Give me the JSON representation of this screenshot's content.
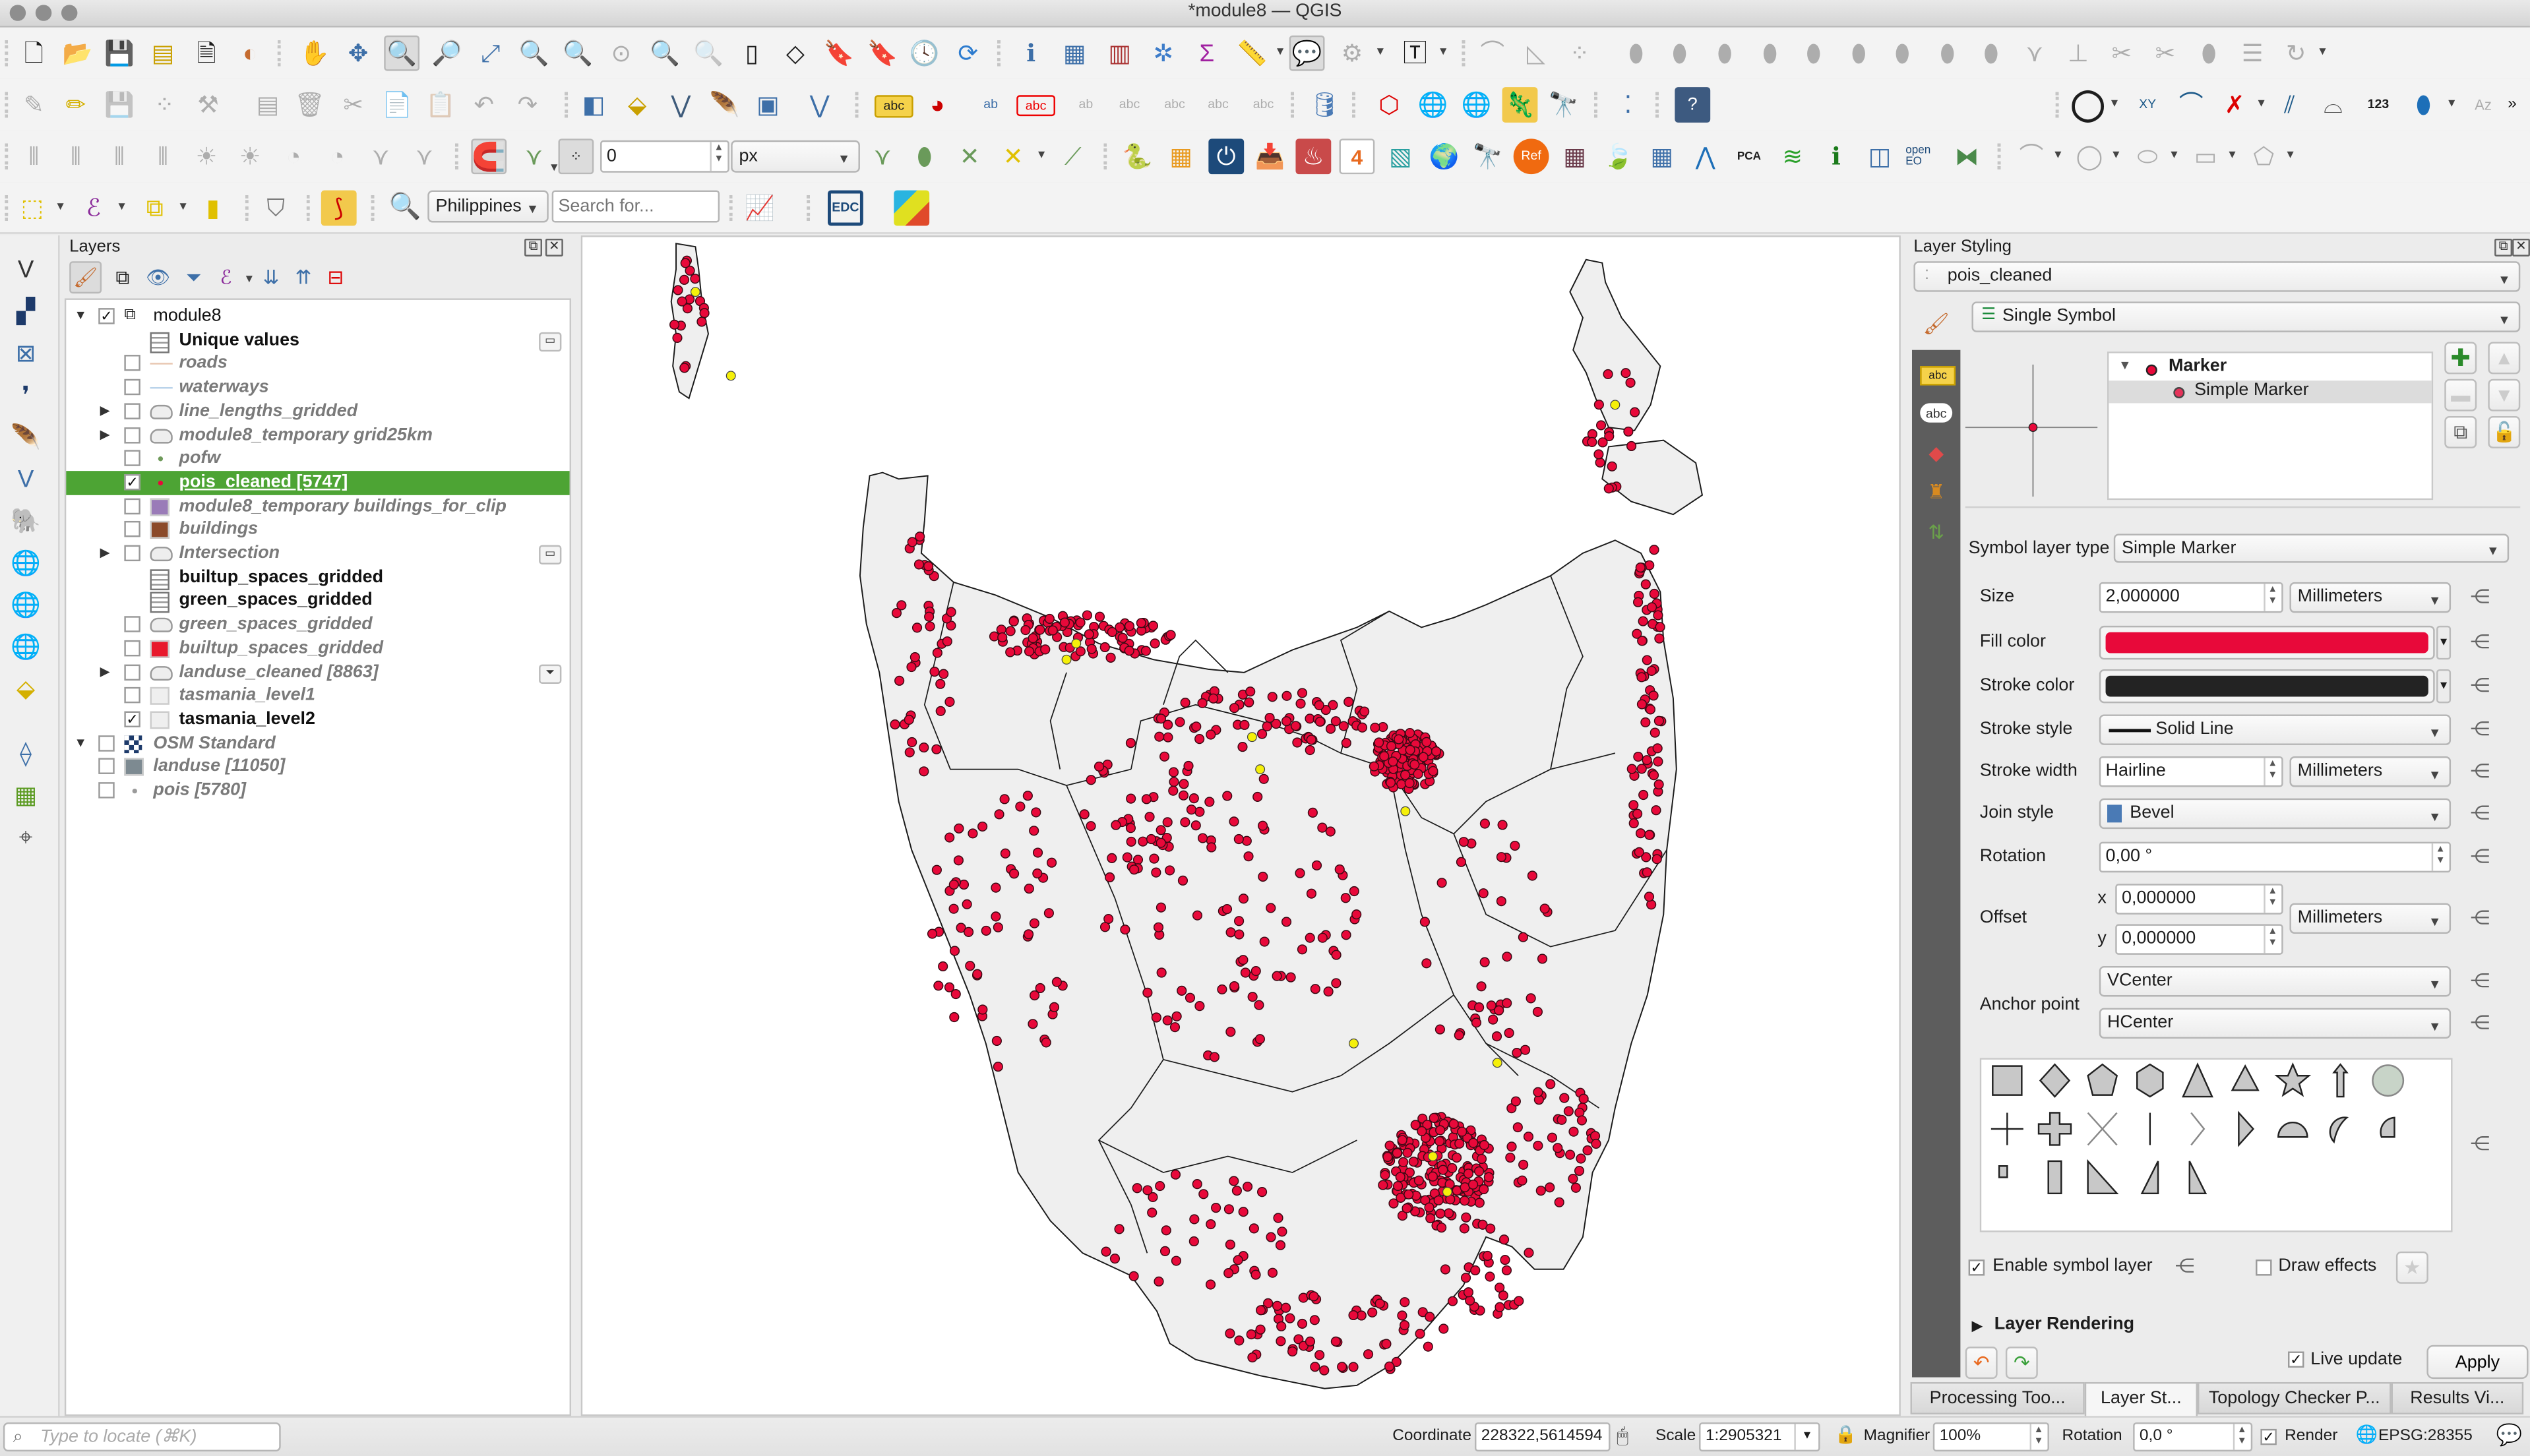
{
  "window": {
    "title": "*module8 — QGIS"
  },
  "toolbar": {
    "snapping_tolerance_value": "0",
    "snapping_units": "px",
    "geocoder_country": "Philippines",
    "geocoder_search_placeholder": "Search for...",
    "edc_label": "EDC",
    "abc_label": "abc",
    "ref_label": "Ref",
    "pca_label": "PCA",
    "num_label": "123",
    "openeo_label": "open EO",
    "xy_label": "XY",
    "four_label": "4"
  },
  "layers_panel": {
    "title": "Layers",
    "items": [
      {
        "name": "module8",
        "kind": "group",
        "checked": true,
        "expanded": true
      },
      {
        "name": "Unique values",
        "kind": "table",
        "style": "bold"
      },
      {
        "name": "roads",
        "kind": "line",
        "checked": false,
        "style": "italic",
        "color": "#e8c6b0"
      },
      {
        "name": "waterways",
        "kind": "line",
        "checked": false,
        "style": "italic",
        "color": "#b9d3ea"
      },
      {
        "name": "line_lengths_gridded",
        "kind": "polygon-outline",
        "checked": false,
        "style": "italic",
        "collapsed": true
      },
      {
        "name": "module8_temporary grid25km",
        "kind": "polygon-outline",
        "checked": false,
        "style": "italic",
        "collapsed": true
      },
      {
        "name": "pofw",
        "kind": "point",
        "checked": false,
        "style": "italic",
        "color": "#6f9a5a"
      },
      {
        "name": "pois_cleaned [5747]",
        "kind": "point",
        "checked": true,
        "style": "selected",
        "color": "#e8093a"
      },
      {
        "name": "module8_temporary buildings_for_clip",
        "kind": "fill",
        "checked": false,
        "style": "italic",
        "color": "#9a7bb8"
      },
      {
        "name": "buildings",
        "kind": "fill",
        "checked": false,
        "style": "italic",
        "color": "#8b4a2a"
      },
      {
        "name": "Intersection",
        "kind": "polygon-outline",
        "checked": false,
        "style": "italic",
        "collapsed": true
      },
      {
        "name": "builtup_spaces_gridded",
        "kind": "table",
        "style": "bold"
      },
      {
        "name": "green_spaces_gridded",
        "kind": "table",
        "style": "bold"
      },
      {
        "name": "green_spaces_gridded",
        "kind": "polygon-outline",
        "checked": false,
        "style": "italic"
      },
      {
        "name": "builtup_spaces_gridded",
        "kind": "fill",
        "checked": false,
        "style": "italic",
        "color": "#e8192c"
      },
      {
        "name": "landuse_cleaned [8863]",
        "kind": "polygon-outline",
        "checked": false,
        "style": "italic",
        "collapsed": true
      },
      {
        "name": "tasmania_level1",
        "kind": "fill",
        "checked": false,
        "style": "italic",
        "color": "#efefef"
      },
      {
        "name": "tasmania_level2",
        "kind": "fill",
        "checked": true,
        "style": "bold",
        "color": "#efefef"
      },
      {
        "name": "OSM Standard",
        "kind": "raster",
        "checked": false,
        "style": "italic",
        "expanded": true
      },
      {
        "name": "landuse [11050]",
        "kind": "fill",
        "checked": false,
        "style": "italic",
        "color": "#7d8a91"
      },
      {
        "name": "pois [5780]",
        "kind": "point",
        "checked": false,
        "style": "italic",
        "color": "#9a9a9a"
      }
    ]
  },
  "map": {
    "land_color": "#efefef",
    "border_color": "#1a1a1a",
    "point_fill": "#e8093a",
    "point_stroke": "#3a0a14",
    "highlight_point_fill": "#f5f00a"
  },
  "layer_styling": {
    "title": "Layer Styling",
    "layer": "pois_cleaned",
    "renderer": "Single Symbol",
    "symbol_tree": {
      "root": "Marker",
      "child": "Simple Marker"
    },
    "symbol_layer_type_label": "Symbol layer type",
    "symbol_layer_type": "Simple Marker",
    "properties": {
      "size_label": "Size",
      "size": "2,000000",
      "size_unit": "Millimeters",
      "fill_color_label": "Fill color",
      "fill_color": "#e8093a",
      "stroke_color_label": "Stroke color",
      "stroke_color": "#232323",
      "stroke_style_label": "Stroke style",
      "stroke_style": "Solid Line",
      "stroke_width_label": "Stroke width",
      "stroke_width": "Hairline",
      "stroke_width_unit": "Millimeters",
      "join_style_label": "Join style",
      "join_style": "Bevel",
      "rotation_label": "Rotation",
      "rotation": "0,00 °",
      "offset_label": "Offset",
      "offset_x_label": "x",
      "offset_x": "0,000000",
      "offset_y_label": "y",
      "offset_y": "0,000000",
      "offset_unit": "Millimeters",
      "anchor_label": "Anchor point",
      "anchor_v": "VCenter",
      "anchor_h": "HCenter"
    },
    "marker_shapes": [
      "square",
      "diamond",
      "pentagon",
      "hexagon",
      "triangle",
      "equilateral-triangle",
      "star",
      "arrow",
      "circle",
      "cross",
      "cross-fill",
      "cross2",
      "line",
      "arrowhead",
      "filled-arrowhead",
      "semi-circle",
      "third-circle",
      "quarter-circle",
      "quarter-square",
      "half-square",
      "diagonal-half-square",
      "right-half-triangle",
      "left-half-triangle"
    ],
    "enable_symbol_layer_label": "Enable symbol layer",
    "enable_symbol_layer": true,
    "draw_effects_label": "Draw effects",
    "draw_effects": false,
    "layer_rendering_label": "Layer Rendering",
    "live_update_label": "Live update",
    "live_update": true,
    "apply_label": "Apply"
  },
  "dock_tabs": [
    {
      "label": "Processing Too...",
      "active": false
    },
    {
      "label": "Layer St...",
      "active": true
    },
    {
      "label": "Topology Checker P...",
      "active": false
    },
    {
      "label": "Results Vi...",
      "active": false
    }
  ],
  "statusbar": {
    "locator_placeholder": "Type to locate (⌘K)",
    "coordinate_label": "Coordinate",
    "coordinate": "228322,5614594",
    "scale_label": "Scale",
    "scale": "1:2905321",
    "magnifier_label": "Magnifier",
    "magnifier": "100%",
    "rotation_label": "Rotation",
    "rotation": "0,0 °",
    "render_label": "Render",
    "render": true,
    "crs": "EPSG:28355"
  }
}
